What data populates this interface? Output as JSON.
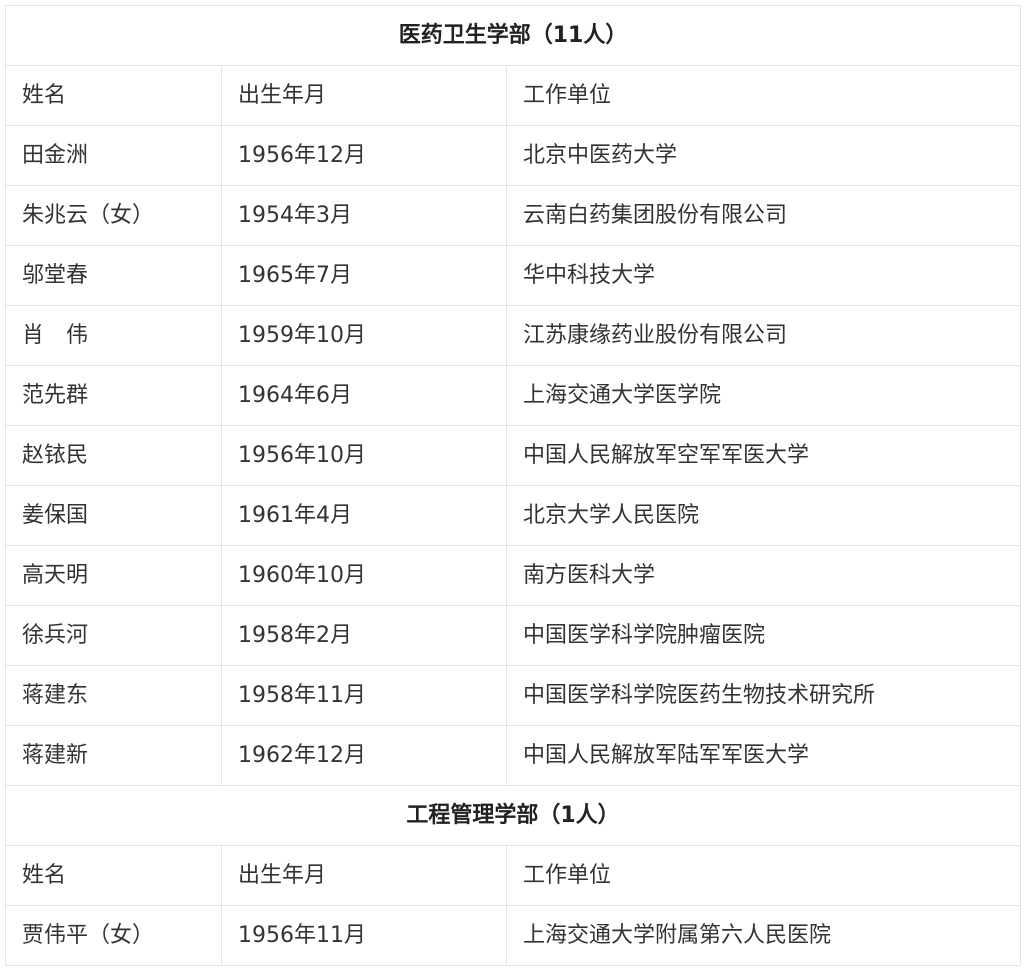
{
  "sections": [
    {
      "title": "医药卫生学部（11人）",
      "headers": [
        "姓名",
        "出生年月",
        "工作单位"
      ],
      "rows": [
        [
          "田金洲",
          "1956年12月",
          "北京中医药大学"
        ],
        [
          "朱兆云（女）",
          "1954年3月",
          "云南白药集团股份有限公司"
        ],
        [
          "邬堂春",
          "1965年7月",
          "华中科技大学"
        ],
        [
          "肖　伟",
          "1959年10月",
          "江苏康缘药业股份有限公司"
        ],
        [
          "范先群",
          "1964年6月",
          "上海交通大学医学院"
        ],
        [
          "赵铱民",
          "1956年10月",
          "中国人民解放军空军军医大学"
        ],
        [
          "姜保国",
          "1961年4月",
          "北京大学人民医院"
        ],
        [
          "高天明",
          "1960年10月",
          "南方医科大学"
        ],
        [
          "徐兵河",
          "1958年2月",
          "中国医学科学院肿瘤医院"
        ],
        [
          "蒋建东",
          "1958年11月",
          "中国医学科学院医药生物技术研究所"
        ],
        [
          "蒋建新",
          "1962年12月",
          "中国人民解放军陆军军医大学"
        ]
      ]
    },
    {
      "title": "工程管理学部（1人）",
      "headers": [
        "姓名",
        "出生年月",
        "工作单位"
      ],
      "rows": [
        [
          "贾伟平（女）",
          "1956年11月",
          "上海交通大学附属第六人民医院"
        ]
      ]
    }
  ]
}
